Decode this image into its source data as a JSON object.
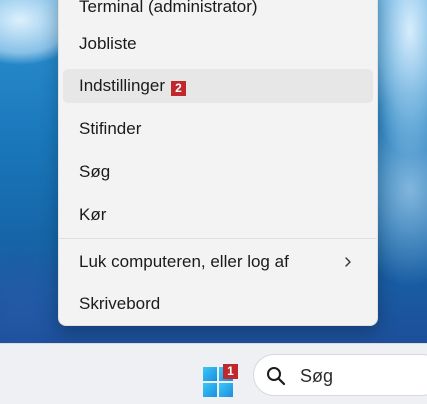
{
  "context_menu": {
    "items": [
      {
        "label": "Terminal (administrator)"
      },
      {
        "label": "Jobliste"
      },
      {
        "label": "Indstillinger",
        "badge": "2"
      },
      {
        "label": "Stifinder"
      },
      {
        "label": "Søg"
      },
      {
        "label": "Kør"
      },
      {
        "label": "Luk computeren, eller log af",
        "icon": "chevron-right-icon"
      },
      {
        "label": "Skrivebord"
      }
    ]
  },
  "taskbar": {
    "start_badge": "1",
    "start_icon": "windows-logo-icon",
    "search_label": "Søg",
    "search_icon": "search-icon"
  },
  "colors": {
    "badge": "#c0282d",
    "start_logo": "#1a8fe0",
    "taskbar": "#eef0f4",
    "menu": "#f3f3f3"
  }
}
